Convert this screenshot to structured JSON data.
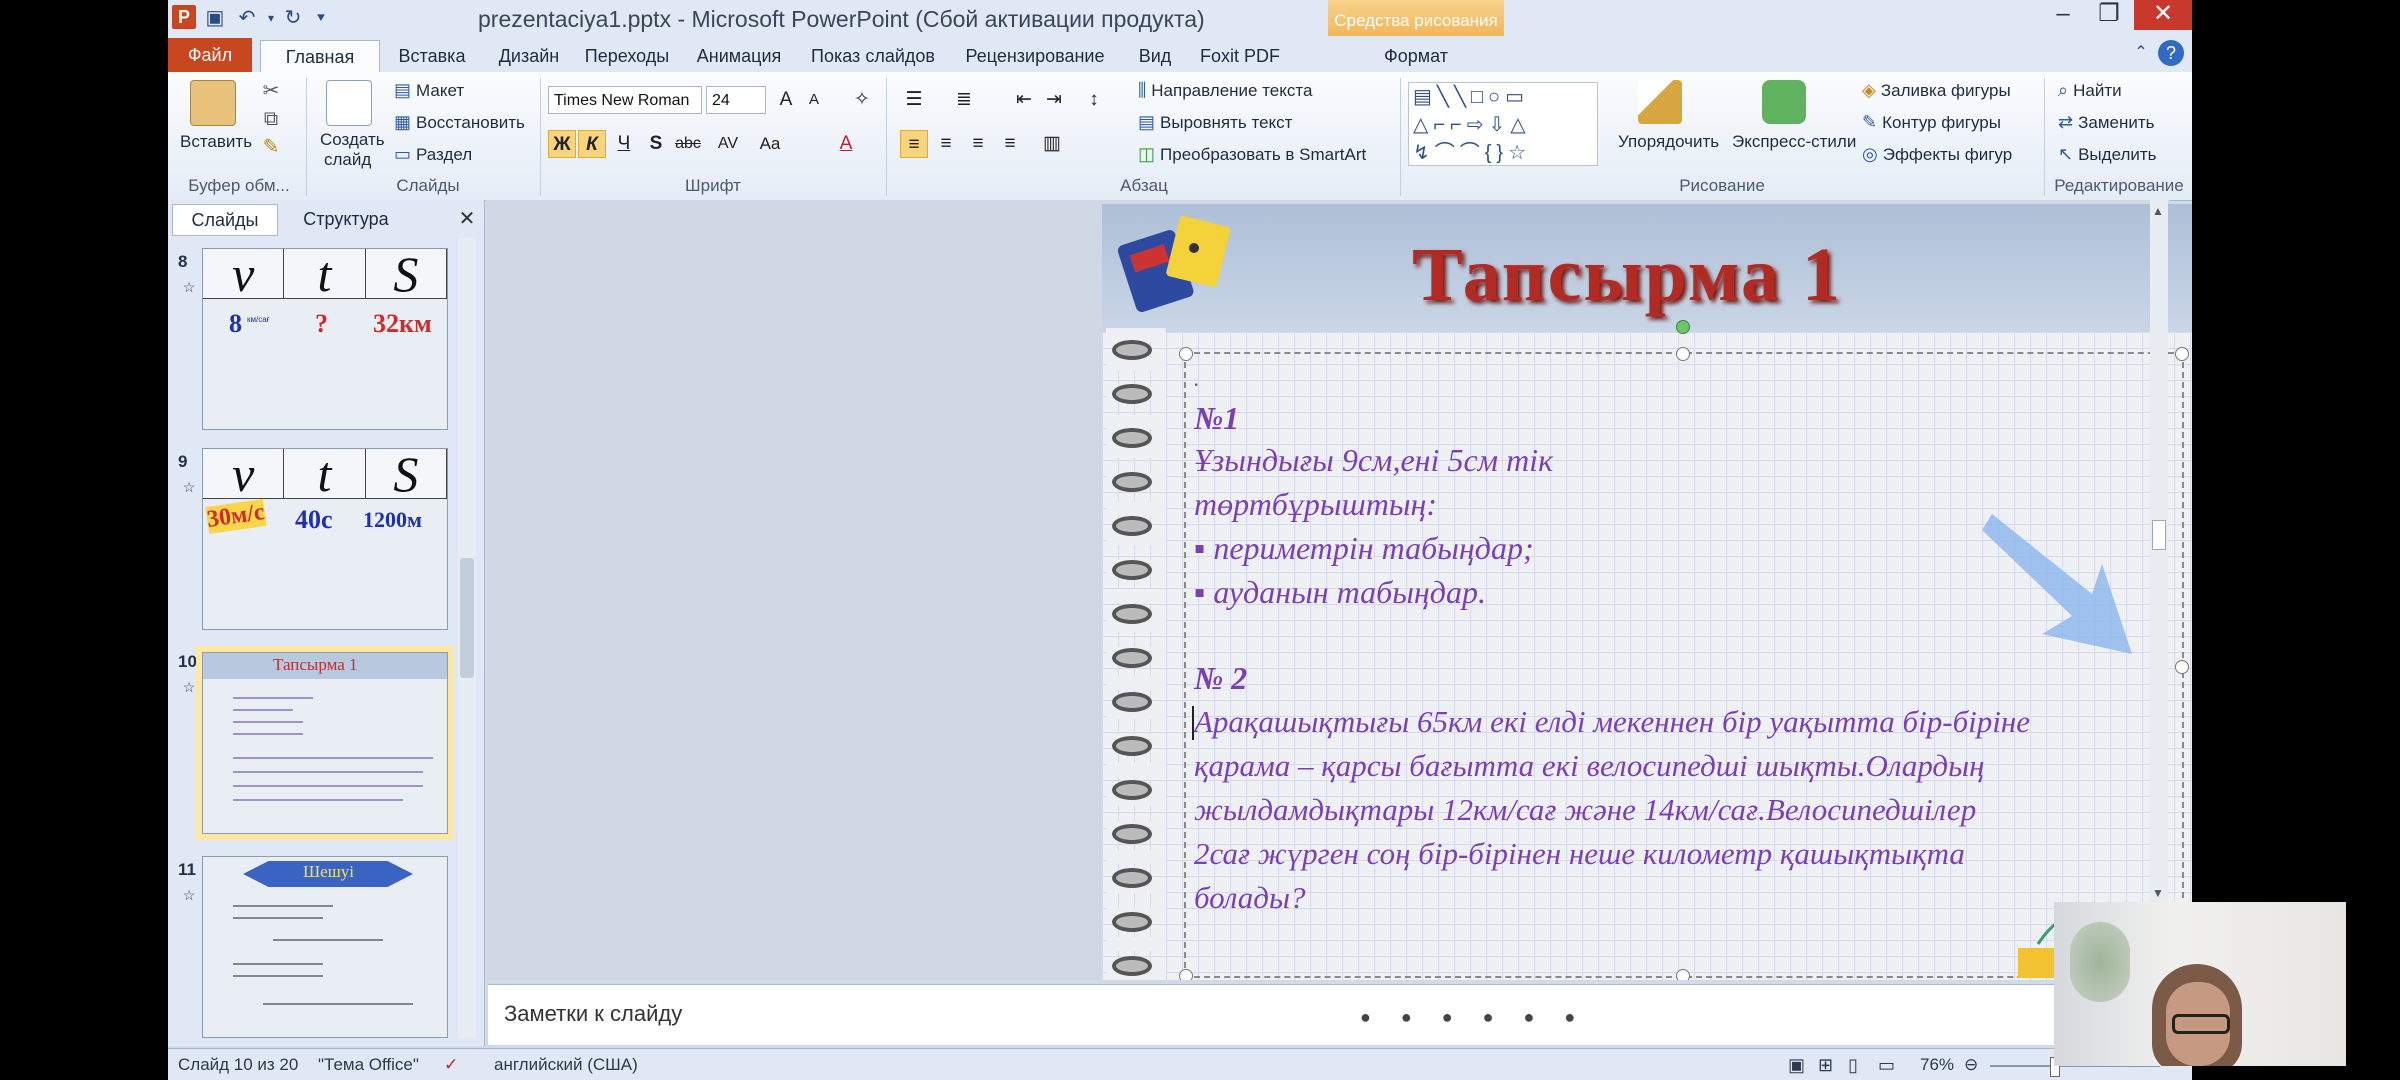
{
  "window": {
    "title": "prezentaciya1.pptx - Microsoft PowerPoint (Сбой активации продукта)",
    "context_tab_header": "Средства рисования",
    "app_icon": "P"
  },
  "tabs": {
    "file": "Файл",
    "items": [
      "Главная",
      "Вставка",
      "Дизайн",
      "Переходы",
      "Анимация",
      "Показ слайдов",
      "Рецензирование",
      "Вид",
      "Foxit PDF",
      "Формат"
    ]
  },
  "ribbon": {
    "clipboard": {
      "paste": "Вставить",
      "label": "Буфер обм..."
    },
    "slides": {
      "new_slide_line1": "Создать",
      "new_slide_line2": "слайд",
      "layout": "Макет",
      "reset": "Восстановить",
      "section": "Раздел",
      "label": "Слайды"
    },
    "font": {
      "name": "Times New Roman",
      "size": "24",
      "bold": "Ж",
      "italic": "К",
      "underline": "Ч",
      "shadow": "S",
      "strike": "abc",
      "spacing": "AV",
      "case": "Aa",
      "color": "A",
      "label": "Шрифт"
    },
    "paragraph": {
      "text_direction": "Направление текста",
      "align_text": "Выровнять текст",
      "smartart": "Преобразовать в SmartArt",
      "label": "Абзац"
    },
    "drawing": {
      "arrange": "Упорядочить",
      "quick_styles": "Экспресс-стили",
      "fill": "Заливка фигуры",
      "outline": "Контур фигуры",
      "effects": "Эффекты фигур",
      "label": "Рисование",
      "shapes_row1": "▤╲╲□○▭",
      "shapes_row2": "△⌐⌐⇨⇩△",
      "shapes_row3": "↯⌒⌒{}☆"
    },
    "editing": {
      "find": "Найти",
      "replace": "Заменить",
      "select": "Выделить",
      "label": "Редактирование"
    }
  },
  "left_pane": {
    "tab_slides": "Слайды",
    "tab_outline": "Структура",
    "thumbnails": [
      {
        "num": "8",
        "v": "v",
        "t": "t",
        "s": "S",
        "val1": "8",
        "val1_unit": "км/сағ",
        "val2": "?",
        "val3": "32км"
      },
      {
        "num": "9",
        "v": "v",
        "t": "t",
        "s": "S",
        "val1": "30м/с",
        "val2": "40с",
        "val3": "1200м"
      },
      {
        "num": "10",
        "title": "Тапсырма 1"
      },
      {
        "num": "11",
        "title": "Шешуі"
      }
    ]
  },
  "slide": {
    "title": "Тапсырма 1",
    "dot": ".",
    "task1_heading": "№1",
    "task1_line1": "Ұзындығы  9см,ені 5см тік",
    "task1_line2": " төртбұрыштың:",
    "task1_bullet1": "▪ периметрін табыңдар;",
    "task1_bullet2": "▪ ауданын табыңдар.",
    "task2_heading": "№ 2",
    "task2_line1": "Арақашықтығы  65км екі елді мекеннен бір уақытта бір-біріне",
    "task2_line2": "қарама – қарсы бағытта  екі велосипедші  шықты.Олардың",
    "task2_line3": "жылдамдықтары  12км/сағ және 14км/сағ.Велосипедшілер",
    "task2_line4": "2сағ жүрген соң бір-бірінен неше километр  қашықтықта",
    "task2_line5": "болады?"
  },
  "notes": {
    "placeholder": "Заметки к слайду",
    "dots": "●●●●●●"
  },
  "status": {
    "slide_counter": "Слайд 10 из 20",
    "theme": "\"Тема Office\"",
    "language": "английский (США)",
    "zoom": "76%"
  }
}
